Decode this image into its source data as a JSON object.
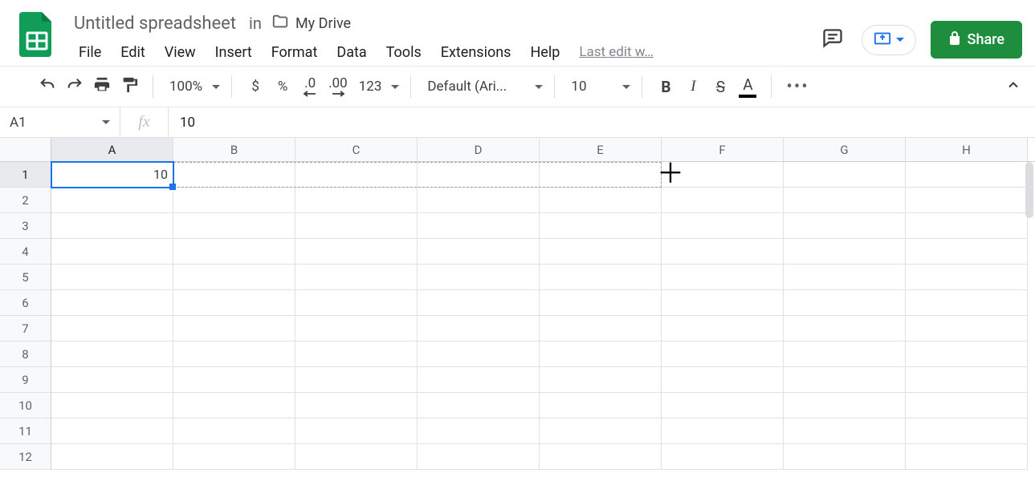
{
  "header": {
    "doc_title": "Untitled spreadsheet",
    "in_label": "in",
    "folder_name": "My Drive",
    "share_label": "Share",
    "last_edit": "Last edit w…"
  },
  "menubar": [
    "File",
    "Edit",
    "View",
    "Insert",
    "Format",
    "Data",
    "Tools",
    "Extensions",
    "Help"
  ],
  "toolbar": {
    "zoom": "100%",
    "currency": "$",
    "percent": "%",
    "dec_dec": ".0",
    "inc_dec": ".00",
    "num_fmt": "123",
    "font": "Default (Ari...",
    "font_size": "10",
    "bold": "B",
    "italic": "I",
    "strike": "S",
    "text_color": "A"
  },
  "formula_bar": {
    "name_box": "A1",
    "fx_symbol": "fx",
    "value": "10"
  },
  "grid": {
    "columns": [
      "A",
      "B",
      "C",
      "D",
      "E",
      "F",
      "G",
      "H"
    ],
    "rows": [
      1,
      2,
      3,
      4,
      5,
      6,
      7,
      8,
      9,
      10,
      11,
      12
    ],
    "selected_cell": "A1",
    "cells": {
      "A1": "10"
    }
  }
}
